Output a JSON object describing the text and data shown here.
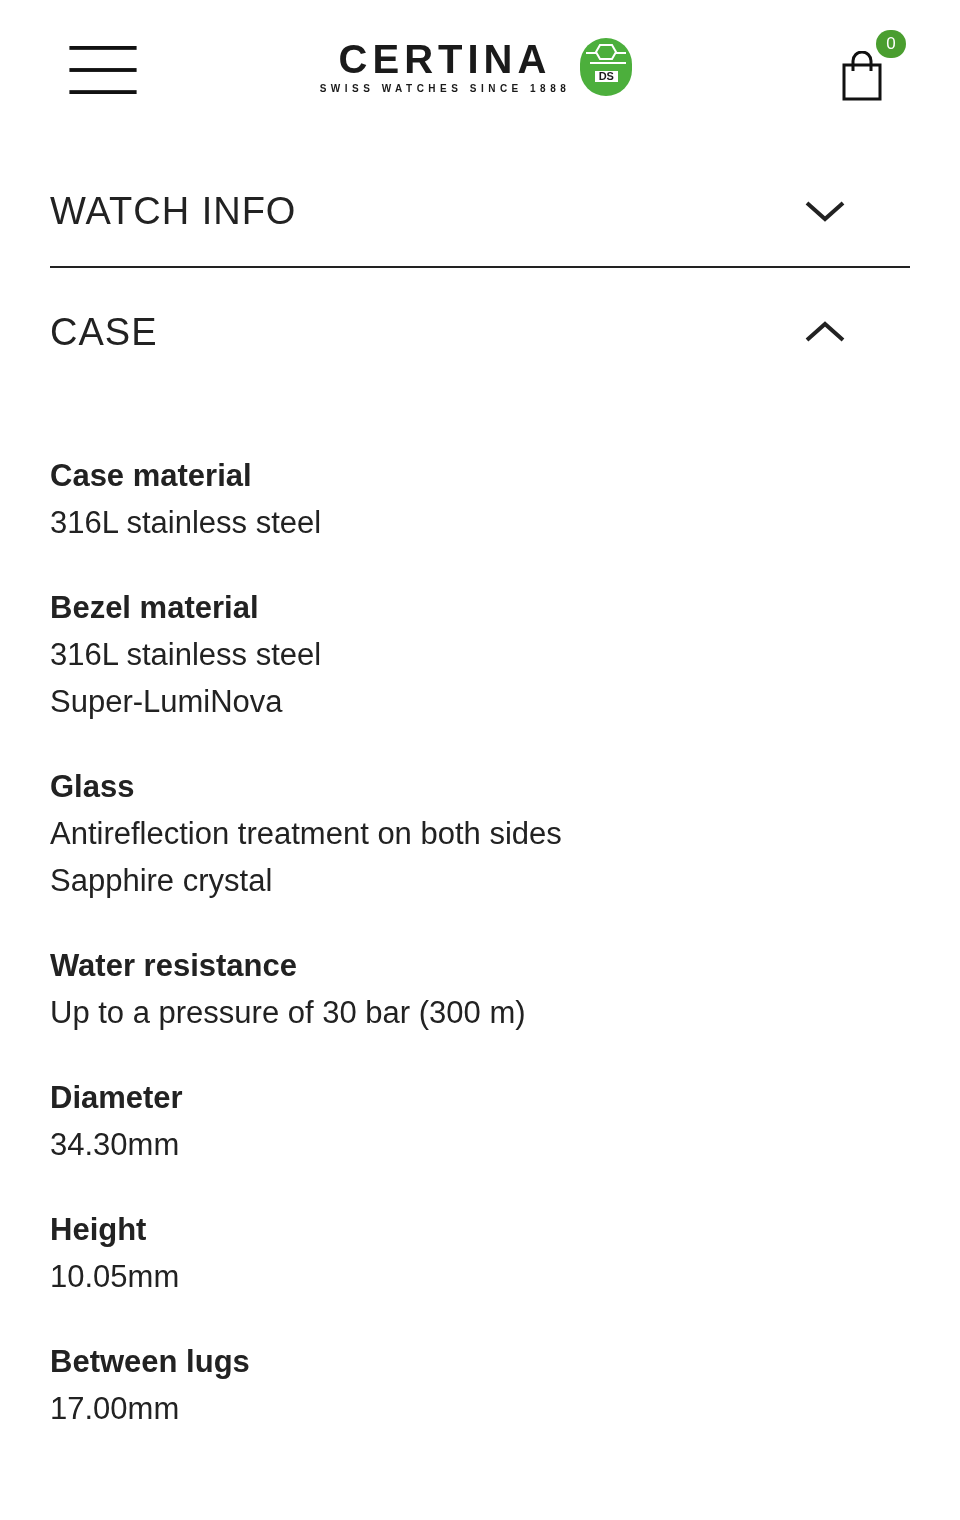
{
  "header": {
    "logo": {
      "wordmark": "CERTINA",
      "tagline": "SWISS WATCHES SINCE 1888",
      "emblem_text": "DS"
    },
    "cart_count": "0"
  },
  "sections": [
    {
      "title": "WATCH INFO",
      "expanded": false
    },
    {
      "title": "CASE",
      "expanded": true,
      "specs": [
        {
          "label": "Case material",
          "values": [
            "316L stainless steel"
          ]
        },
        {
          "label": "Bezel material",
          "values": [
            "316L stainless steel",
            "Super-LumiNova"
          ]
        },
        {
          "label": "Glass",
          "values": [
            "Antireflection treatment on both sides",
            "Sapphire crystal"
          ]
        },
        {
          "label": "Water resistance",
          "values": [
            "Up to a pressure of 30 bar (300 m)"
          ]
        },
        {
          "label": "Diameter",
          "values": [
            "34.30mm"
          ]
        },
        {
          "label": "Height",
          "values": [
            "10.05mm"
          ]
        },
        {
          "label": "Between lugs",
          "values": [
            "17.00mm"
          ]
        }
      ]
    }
  ]
}
